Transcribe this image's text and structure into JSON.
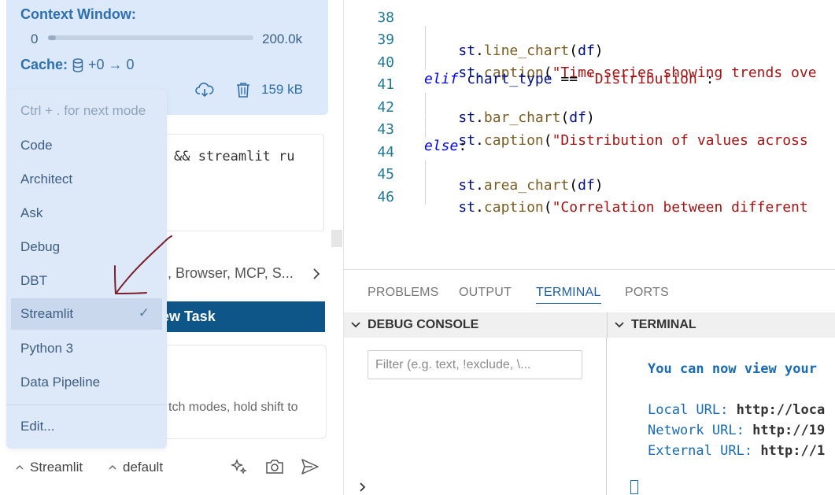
{
  "context": {
    "title": "Context Window:",
    "min": "0",
    "max": "200.0k",
    "usage_fraction": 0.04,
    "cache_label": "Cache:",
    "cache_value": "+0 → 0",
    "size": "159 kB"
  },
  "input": {
    "text": "&& streamlit ru"
  },
  "tools": {
    "text": "d, Browser, MCP, S..."
  },
  "new_task": {
    "label": "ew Task"
  },
  "hint": {
    "text": "tch modes, hold shift to"
  },
  "mode_menu": {
    "hint": "Ctrl + . for next mode",
    "items": [
      "Code",
      "Architect",
      "Ask",
      "Debug",
      "DBT",
      "Streamlit",
      "Python 3",
      "Data Pipeline"
    ],
    "selected": "Streamlit",
    "check": "✓",
    "edit": "Edit..."
  },
  "bottom_bar": {
    "mode": "Streamlit",
    "profile": "default"
  },
  "editor": {
    "line_numbers": [
      "38",
      "39",
      "40",
      "41",
      "42",
      "43",
      "44",
      "45",
      "46"
    ]
  },
  "panel": {
    "tabs": [
      "PROBLEMS",
      "OUTPUT",
      "TERMINAL",
      "PORTS"
    ],
    "active_tab": "TERMINAL",
    "debug_console": "DEBUG CONSOLE",
    "terminal": "TERMINAL",
    "filter_placeholder": "Filter (e.g. text, !exclude, \\..."
  },
  "terminal": {
    "headline": "You can now view your",
    "local_label": "Local URL:",
    "local_url": "http://loca",
    "network_label": "Network URL:",
    "network_url": "http://19",
    "external_label": "External URL:",
    "external_url": "http://1"
  },
  "colors": {
    "accent": "#0e5688",
    "menu_bg": "#dde9f9",
    "annotation_arrow": "#7a1f2b"
  }
}
